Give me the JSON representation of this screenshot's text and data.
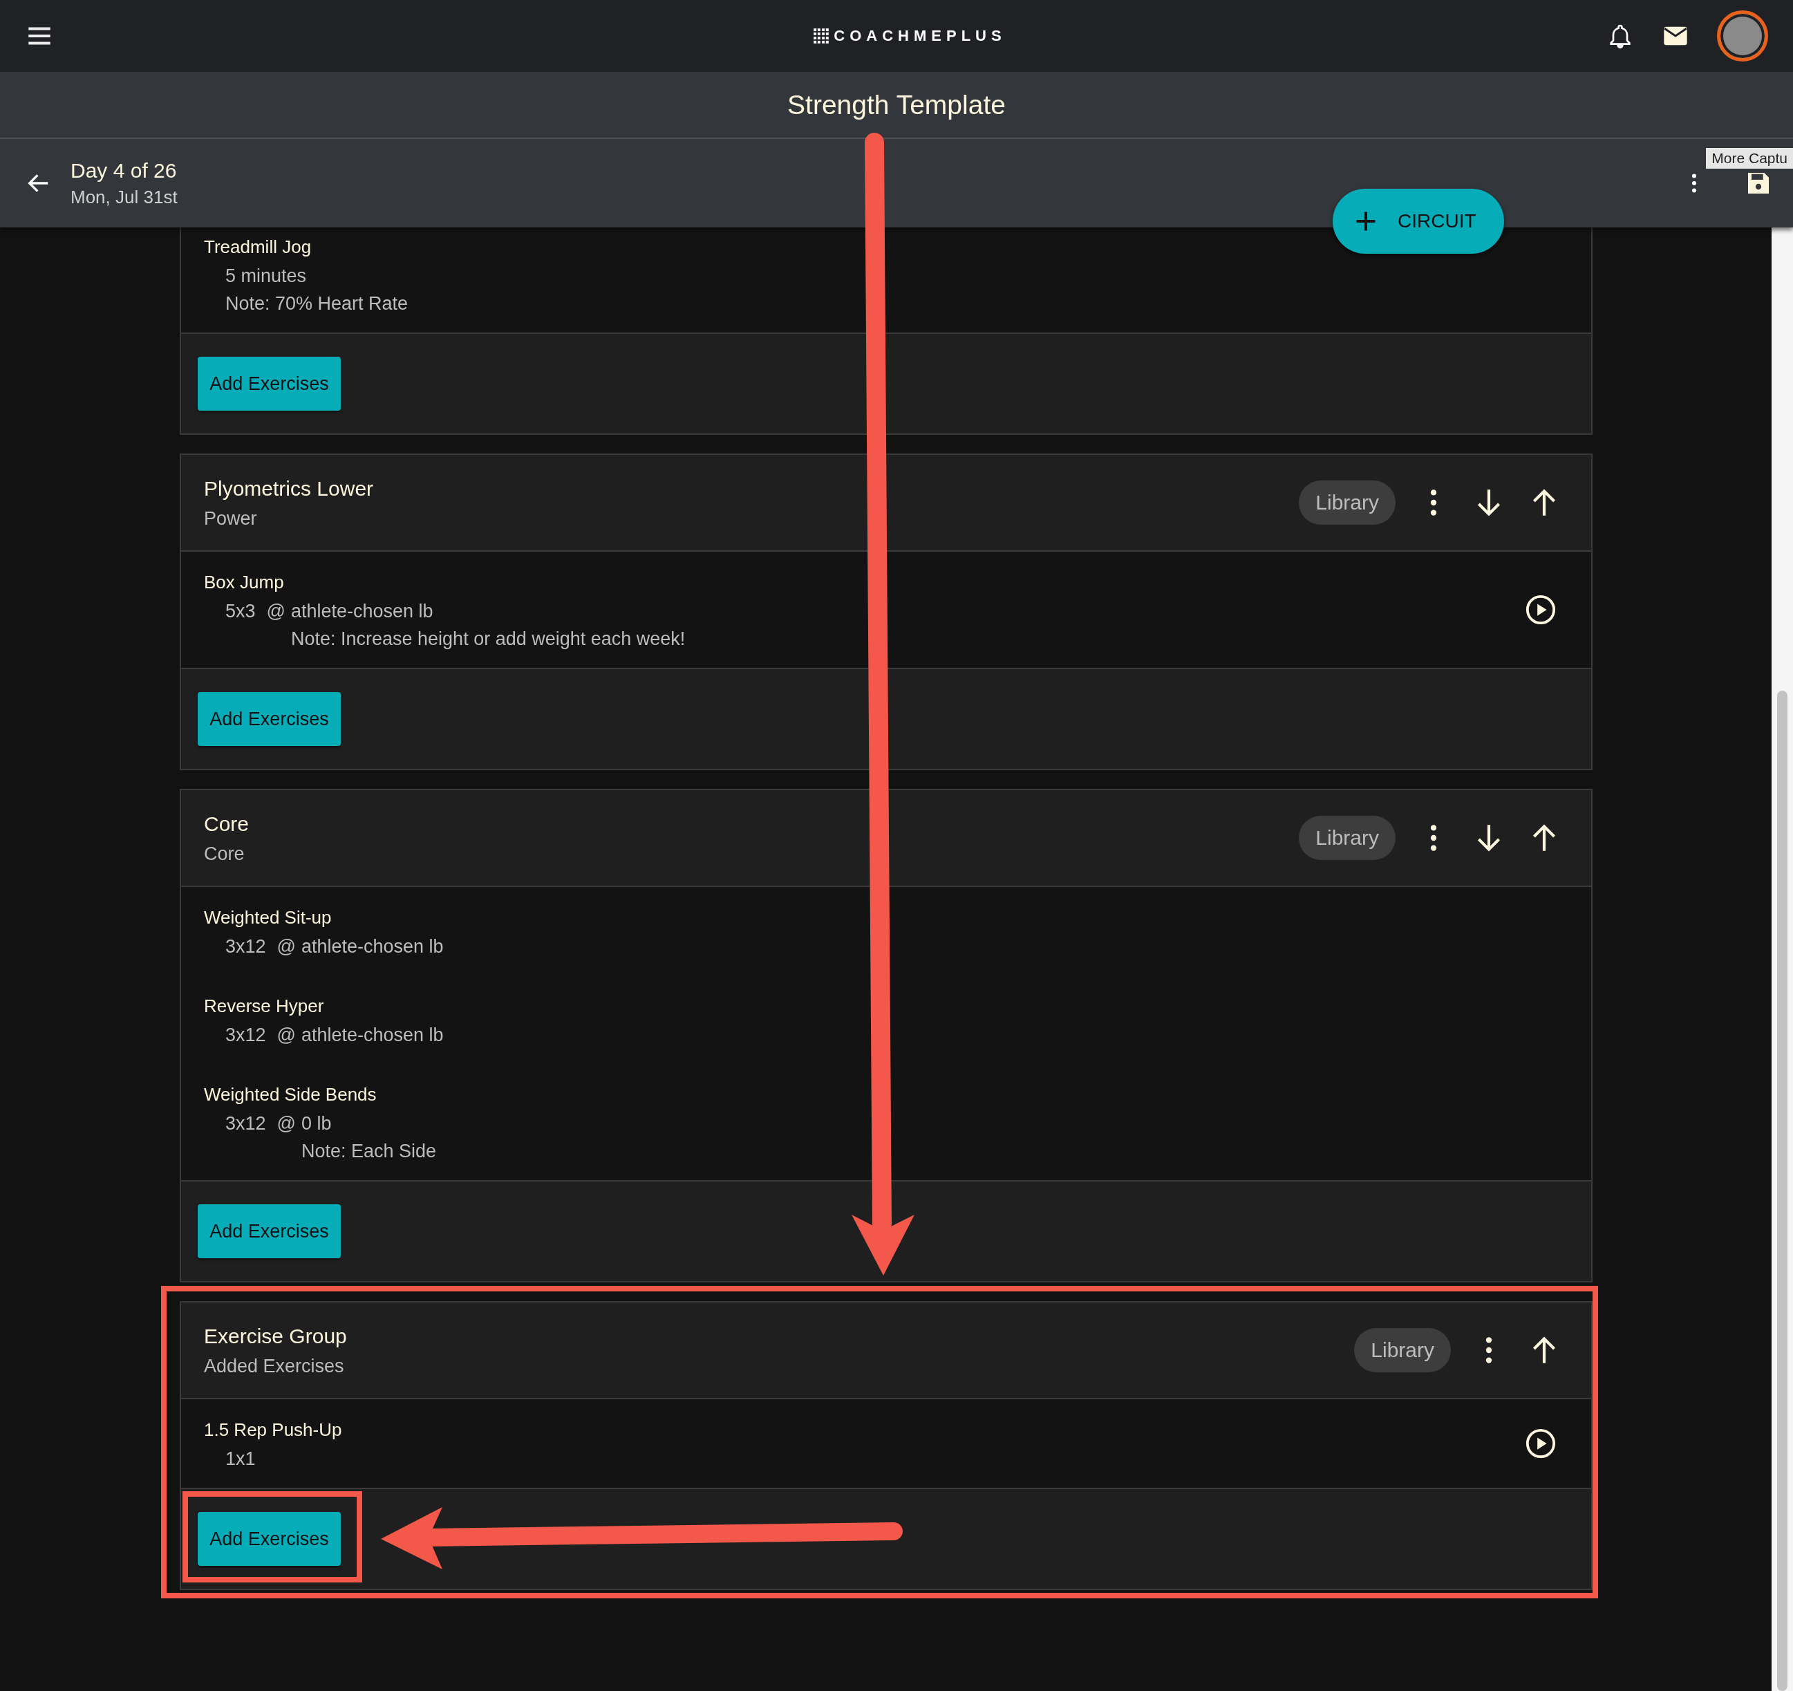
{
  "app": {
    "logo": "COACHMEPLUS"
  },
  "header": {
    "title": "Strength Template",
    "day": "Day 4 of 26",
    "date": "Mon, Jul 31st",
    "tooltip": "More Captu"
  },
  "fab": {
    "label": "CIRCUIT"
  },
  "groups": [
    {
      "exercises": [
        {
          "name": "Treadmill Jog",
          "sets": "5 minutes",
          "note": "Note: 70% Heart Rate",
          "video": false
        }
      ],
      "button": "Add Exercises",
      "highlighted": false
    },
    {
      "title": "Plyometrics Lower",
      "subtitle": "Power",
      "library": "Library",
      "can_move_down": true,
      "exercises": [
        {
          "name": "Box Jump",
          "sets": "5x3",
          "at": "@",
          "load": "athlete-chosen lb",
          "note": "Note: Increase height or add weight each week!",
          "video": true
        }
      ],
      "button": "Add Exercises",
      "highlighted": false
    },
    {
      "title": "Core",
      "subtitle": "Core",
      "library": "Library",
      "can_move_down": true,
      "exercises": [
        {
          "name": "Weighted Sit-up",
          "sets": "3x12",
          "at": "@",
          "load": "athlete-chosen lb",
          "video": false
        },
        {
          "name": "Reverse Hyper",
          "sets": "3x12",
          "at": "@",
          "load": "athlete-chosen lb",
          "video": false
        },
        {
          "name": "Weighted Side Bends",
          "sets": "3x12",
          "at": "@",
          "load": "0 lb",
          "note": "Note: Each Side",
          "video": false
        }
      ],
      "button": "Add Exercises",
      "highlighted": false
    },
    {
      "title": "Exercise Group",
      "subtitle": "Added Exercises",
      "library": "Library",
      "can_move_down": false,
      "exercises": [
        {
          "name": "1.5 Rep Push-Up",
          "sets": "1x1",
          "video": true
        }
      ],
      "button": "Add Exercises",
      "highlighted": true
    }
  ]
}
